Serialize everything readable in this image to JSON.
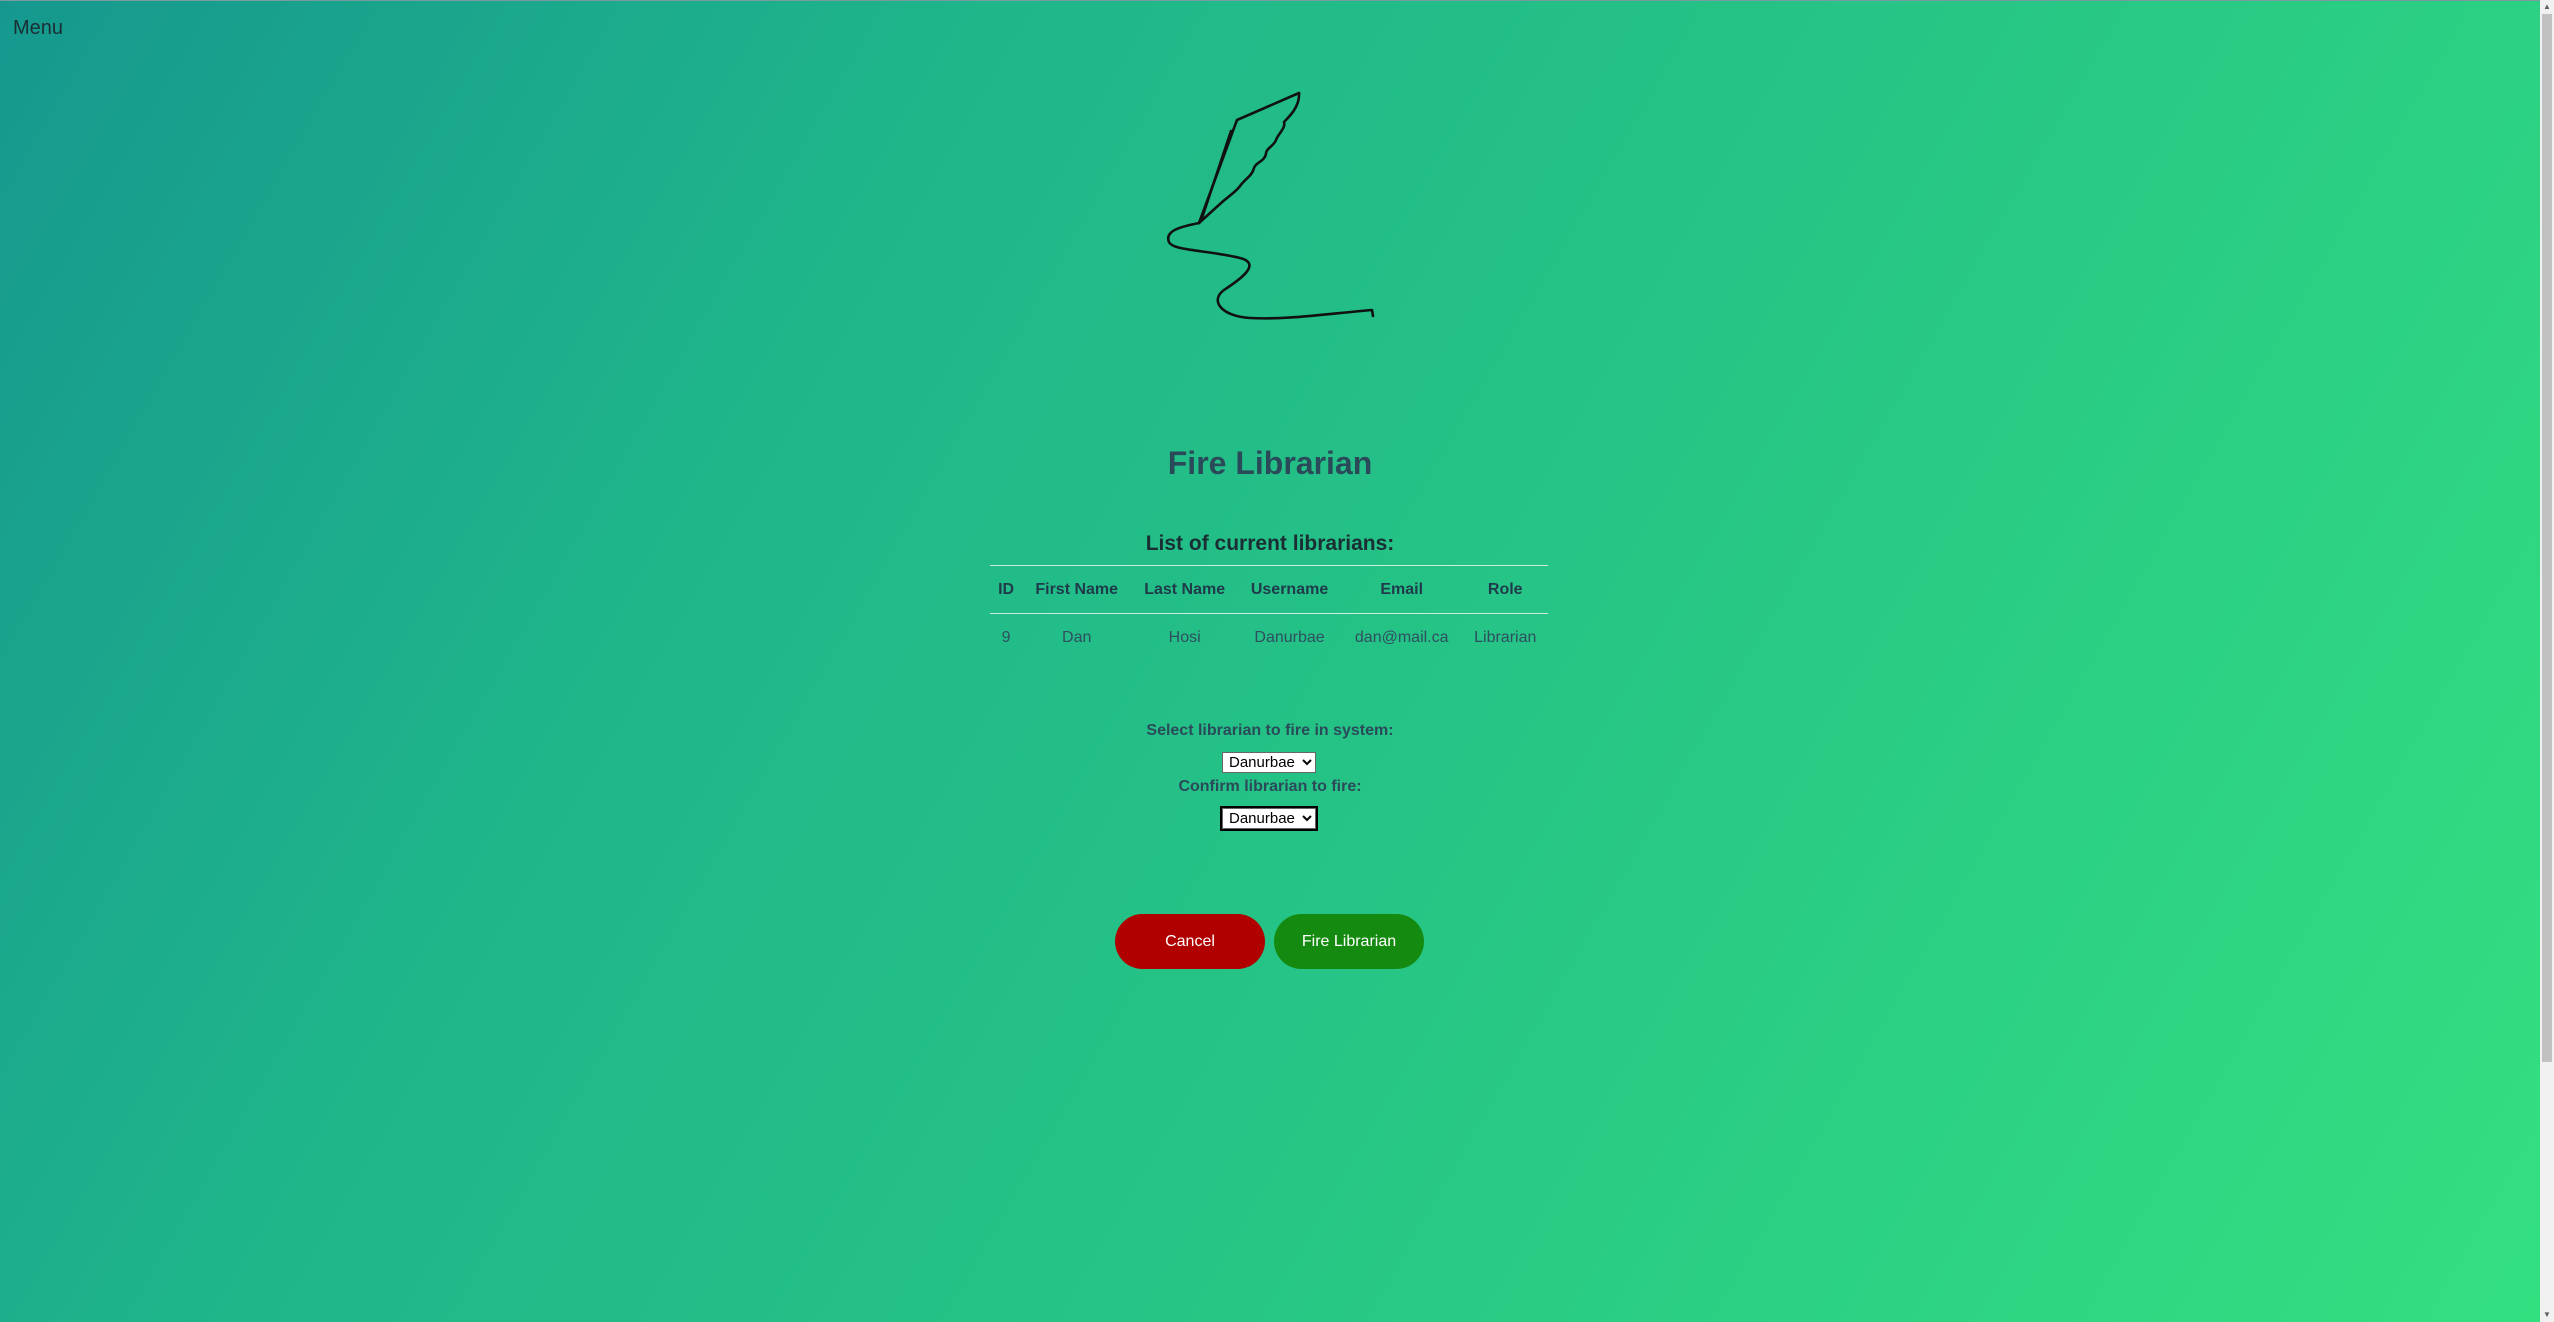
{
  "nav": {
    "menu_label": "Menu"
  },
  "page": {
    "title": "Fire Librarian",
    "list_heading": "List of current librarians:"
  },
  "table": {
    "columns": [
      "ID",
      "First Name",
      "Last Name",
      "Username",
      "Email",
      "Role"
    ],
    "rows": [
      [
        "9",
        "Dan",
        "Hosi",
        "Danurbae",
        "dan@mail.ca",
        "Librarian"
      ]
    ]
  },
  "form": {
    "select_label": "Select librarian to fire in system:",
    "select_value": "Danurbae",
    "confirm_label": "Confirm librarian to fire:",
    "confirm_value": "Danurbae"
  },
  "buttons": {
    "cancel": "Cancel",
    "fire": "Fire Librarian"
  },
  "colors": {
    "cancel": "#b00000",
    "fire": "#158a10"
  },
  "icons": {
    "logo": "quill-pen-icon"
  }
}
